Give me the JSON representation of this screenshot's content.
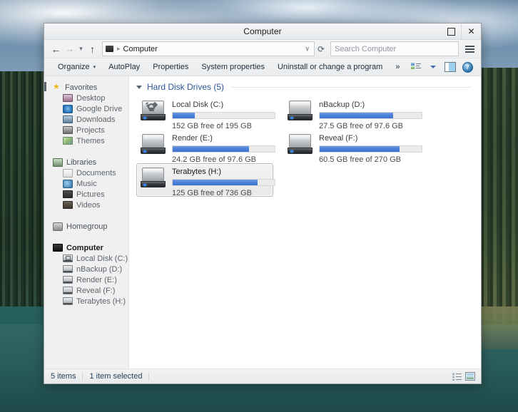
{
  "window": {
    "title": "Computer",
    "buttons": {
      "maximize": "maximize-icon",
      "close": "✕"
    }
  },
  "addressbar": {
    "back_icon": "←",
    "forward_icon": "→",
    "history_icon": "▾",
    "up_icon": "↑",
    "path_label": "Computer",
    "path_separator": "▸",
    "dropdown_icon": "∨",
    "refresh_icon": "⟳",
    "search_placeholder": "Search Computer",
    "menu_icon": "hamburger-icon"
  },
  "commandbar": {
    "items": [
      {
        "label": "Organize",
        "has_caret": true
      },
      {
        "label": "AutoPlay",
        "has_caret": false
      },
      {
        "label": "Properties",
        "has_caret": false
      },
      {
        "label": "System properties",
        "has_caret": false
      },
      {
        "label": "Uninstall or change a program",
        "has_caret": false
      }
    ],
    "overflow_label": "»",
    "caret": "▾",
    "help_label": "?"
  },
  "navpane": {
    "groups": [
      {
        "root": {
          "label": "Favorites",
          "icon": "star-icon"
        },
        "children": [
          {
            "label": "Desktop",
            "icon": "desktop-icon"
          },
          {
            "label": "Google Drive",
            "icon": "google-drive-icon"
          },
          {
            "label": "Downloads",
            "icon": "downloads-icon"
          },
          {
            "label": "Projects",
            "icon": "projects-folder-icon"
          },
          {
            "label": "Themes",
            "icon": "themes-folder-icon"
          }
        ]
      },
      {
        "root": {
          "label": "Libraries",
          "icon": "libraries-icon"
        },
        "children": [
          {
            "label": "Documents",
            "icon": "documents-icon"
          },
          {
            "label": "Music",
            "icon": "music-icon"
          },
          {
            "label": "Pictures",
            "icon": "pictures-icon"
          },
          {
            "label": "Videos",
            "icon": "videos-icon"
          }
        ]
      },
      {
        "root": {
          "label": "Homegroup",
          "icon": "homegroup-icon"
        },
        "children": []
      },
      {
        "root": {
          "label": "Computer",
          "icon": "computer-icon",
          "selected": true
        },
        "children": [
          {
            "label": "Local Disk (C:)",
            "icon": "system-disk-icon"
          },
          {
            "label": "nBackup (D:)",
            "icon": "disk-icon"
          },
          {
            "label": "Render (E:)",
            "icon": "disk-icon"
          },
          {
            "label": "Reveal (F:)",
            "icon": "disk-icon"
          },
          {
            "label": "Terabytes (H:)",
            "icon": "disk-icon"
          }
        ]
      }
    ]
  },
  "content": {
    "group_header": "Hard Disk Drives (5)",
    "collapse_icon": "triangle-down-icon",
    "drives": [
      {
        "name": "Local Disk (C:)",
        "capacity_text": "152 GB free of 195 GB",
        "used_percent": 22,
        "icon": "system-hard-drive-icon",
        "selected": false
      },
      {
        "name": "nBackup (D:)",
        "capacity_text": "27.5 GB free of 97.6 GB",
        "used_percent": 72,
        "icon": "hard-drive-icon",
        "selected": false
      },
      {
        "name": "Render (E:)",
        "capacity_text": "24.2 GB free of 97.6 GB",
        "used_percent": 75,
        "icon": "hard-drive-icon",
        "selected": false
      },
      {
        "name": "Reveal (F:)",
        "capacity_text": "60.5 GB free of 270 GB",
        "used_percent": 78,
        "icon": "hard-drive-icon",
        "selected": false
      },
      {
        "name": "Terabytes (H:)",
        "capacity_text": "125 GB free of 736 GB",
        "used_percent": 83,
        "icon": "hard-drive-icon",
        "selected": true
      }
    ]
  },
  "statusbar": {
    "item_count": "5 items",
    "selection": "1 item selected",
    "view_details_icon": "details-view-icon",
    "view_large_icon": "large-icons-view-icon"
  },
  "colors": {
    "accent_blue": "#4a80d8",
    "group_header_blue": "#2b5797",
    "window_bg": "#f0f0f0",
    "content_bg": "#ffffff"
  }
}
